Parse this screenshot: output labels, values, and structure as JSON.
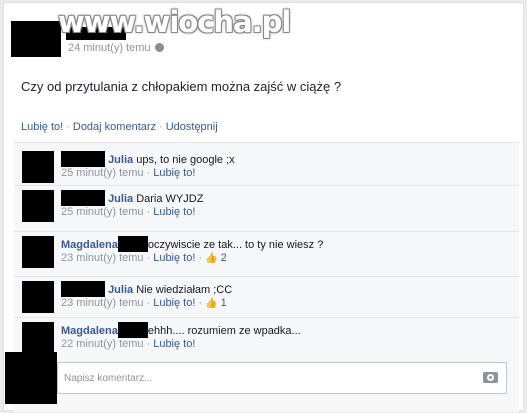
{
  "watermark": "www.wiocha.pl",
  "post": {
    "timestamp": "24 minut(y) temu",
    "text": "Czy od przytulania z chłopakiem można zajść w ciążę ?",
    "actions": {
      "like": "Lubię to!",
      "comment": "Dodaj komentarz",
      "share": "Udostępnij"
    }
  },
  "comments": [
    {
      "author": "Julia",
      "text": "ups, to nie google ;x",
      "time": "25 minut(y) temu",
      "like_label": "Lubię to!",
      "likes": ""
    },
    {
      "author": "Julia",
      "text": "Daria WYJDZ",
      "time": "25 minut(y) temu",
      "like_label": "Lubię to!",
      "likes": ""
    },
    {
      "author": "Magdalena",
      "text": "oczywiscie ze tak... to ty nie wiesz ?",
      "time": "23 minut(y) temu",
      "like_label": "Lubię to!",
      "likes": "2"
    },
    {
      "author": "Julia",
      "text": "Nie wiedziałam ;CC",
      "time": "23 minut(y) temu",
      "like_label": "Lubię to!",
      "likes": "1"
    },
    {
      "author": "Magdalena",
      "text": "ehhh.... rozumiem ze wpadka...",
      "time": "22 minut(y) temu",
      "like_label": "Lubię to!",
      "likes": ""
    }
  ],
  "compose": {
    "placeholder": "Napisz komentarz..."
  },
  "icons": {
    "globe": "globe-icon",
    "thumb": "thumbs-up-icon",
    "camera": "camera-icon"
  },
  "colors": {
    "link": "#3b5998",
    "meta": "#90949c",
    "redaction": "#000000"
  }
}
